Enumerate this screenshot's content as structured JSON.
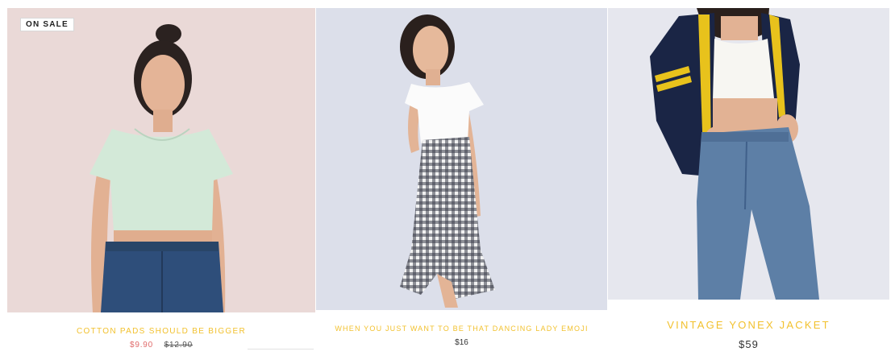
{
  "theme": {
    "title_color": "#f2c12e",
    "sale_color": "#e06a6a"
  },
  "products": [
    {
      "badge": "ON SALE",
      "title": "COTTON PADS SHOULD BE BIGGER",
      "price_sale": "$9.90",
      "price_original": "$12.90"
    },
    {
      "title": "WHEN YOU JUST WANT TO BE THAT DANCING LADY EMOJI",
      "price": "$16"
    },
    {
      "title": "VINTAGE YONEX JACKET",
      "price": "$59"
    }
  ]
}
